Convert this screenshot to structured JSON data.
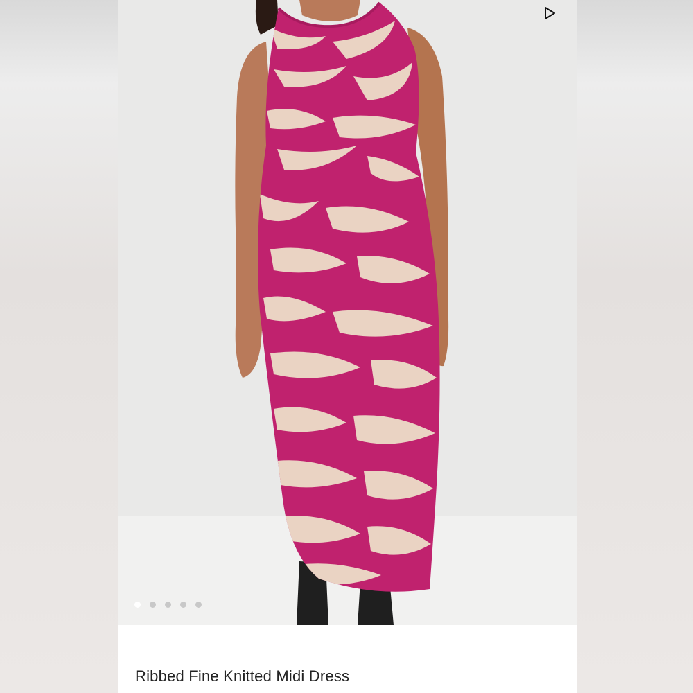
{
  "product": {
    "title": "Ribbed Fine Knitted Midi Dress"
  },
  "gallery": {
    "image_count": 5,
    "active_index": 0,
    "video_control": "play-icon"
  },
  "colors": {
    "dress_primary": "#c0226e",
    "dress_pattern": "#ead3c3",
    "skin": "#b97a5a",
    "boots": "#1f1f1f"
  }
}
